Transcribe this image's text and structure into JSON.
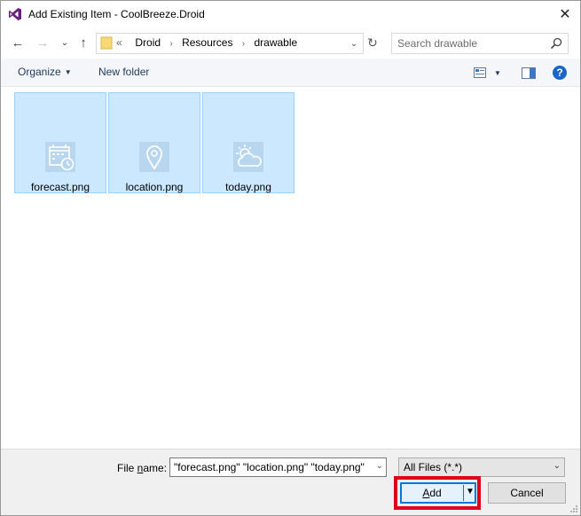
{
  "window": {
    "title": "Add Existing Item - CoolBreeze.Droid",
    "close_glyph": "✕"
  },
  "nav": {
    "back_glyph": "←",
    "forward_glyph": "→",
    "recent_glyph": "⌄",
    "up_glyph": "↑"
  },
  "address": {
    "overflow": "«",
    "crumbs": [
      "Droid",
      "Resources",
      "drawable"
    ],
    "separator": "›",
    "dropdown_glyph": "⌄",
    "refresh_glyph": "↻"
  },
  "search": {
    "placeholder": "Search drawable"
  },
  "toolbar": {
    "organize_label": "Organize",
    "new_folder_label": "New folder",
    "help_label": "?"
  },
  "files": [
    {
      "name": "forecast.png",
      "icon": "calendar-clock-icon"
    },
    {
      "name": "location.png",
      "icon": "map-pin-icon"
    },
    {
      "name": "today.png",
      "icon": "sun-cloud-icon"
    }
  ],
  "footer": {
    "file_name_label_prefix": "File ",
    "file_name_label_access": "n",
    "file_name_label_suffix": "ame:",
    "file_name_value": "\"forecast.png\" \"location.png\" \"today.png\"",
    "filter_value": "All Files (*.*)",
    "add_label_access": "A",
    "add_label_rest": "dd",
    "cancel_label": "Cancel"
  },
  "colors": {
    "selection_fill": "#cce8ff",
    "selection_border": "#99d1ff",
    "accent": "#0078d7",
    "highlight": "#e0001a"
  }
}
